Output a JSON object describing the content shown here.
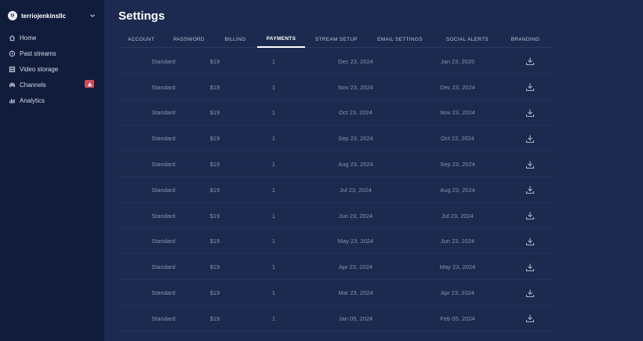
{
  "account": {
    "name": "terriojenkinsllc",
    "avatar_text": "tjl"
  },
  "sidebar": {
    "items": [
      {
        "label": "Home",
        "icon": "home-icon"
      },
      {
        "label": "Past streams",
        "icon": "history-icon"
      },
      {
        "label": "Video storage",
        "icon": "film-icon"
      },
      {
        "label": "Channels",
        "icon": "broadcast-icon",
        "badge": "warning-icon"
      },
      {
        "label": "Analytics",
        "icon": "bar-chart-icon"
      }
    ]
  },
  "page": {
    "title": "Settings"
  },
  "tabs": [
    {
      "label": "ACCOUNT"
    },
    {
      "label": "PASSWORD"
    },
    {
      "label": "BILLING"
    },
    {
      "label": "PAYMENTS",
      "active": true
    },
    {
      "label": "STREAM SETUP"
    },
    {
      "label": "EMAIL SETTINGS"
    },
    {
      "label": "SOCIAL ALERTS"
    },
    {
      "label": "BRANDING"
    }
  ],
  "payments": [
    {
      "plan": "Standard",
      "amount": "$19",
      "qty": "1",
      "start": "Dec 23, 2024",
      "end": "Jan 23, 2025"
    },
    {
      "plan": "Standard",
      "amount": "$19",
      "qty": "1",
      "start": "Nov 23, 2024",
      "end": "Dec 23, 2024"
    },
    {
      "plan": "Standard",
      "amount": "$19",
      "qty": "1",
      "start": "Oct 23, 2024",
      "end": "Nov 23, 2024"
    },
    {
      "plan": "Standard",
      "amount": "$19",
      "qty": "1",
      "start": "Sep 23, 2024",
      "end": "Oct 23, 2024"
    },
    {
      "plan": "Standard",
      "amount": "$19",
      "qty": "1",
      "start": "Aug 23, 2024",
      "end": "Sep 23, 2024"
    },
    {
      "plan": "Standard",
      "amount": "$19",
      "qty": "1",
      "start": "Jul 23, 2024",
      "end": "Aug 23, 2024"
    },
    {
      "plan": "Standard",
      "amount": "$19",
      "qty": "1",
      "start": "Jun 23, 2024",
      "end": "Jul 23, 2024"
    },
    {
      "plan": "Standard",
      "amount": "$19",
      "qty": "1",
      "start": "May 23, 2024",
      "end": "Jun 23, 2024"
    },
    {
      "plan": "Standard",
      "amount": "$19",
      "qty": "1",
      "start": "Apr 23, 2024",
      "end": "May 23, 2024"
    },
    {
      "plan": "Standard",
      "amount": "$19",
      "qty": "1",
      "start": "Mar 23, 2024",
      "end": "Apr 23, 2024"
    },
    {
      "plan": "Standard",
      "amount": "$19",
      "qty": "1",
      "start": "Jan 05, 2024",
      "end": "Feb 05, 2024"
    }
  ],
  "colors": {
    "sidebar_bg": "#111c3d",
    "main_bg": "#1c2a4f",
    "warning_badge": "#d64a5c"
  }
}
